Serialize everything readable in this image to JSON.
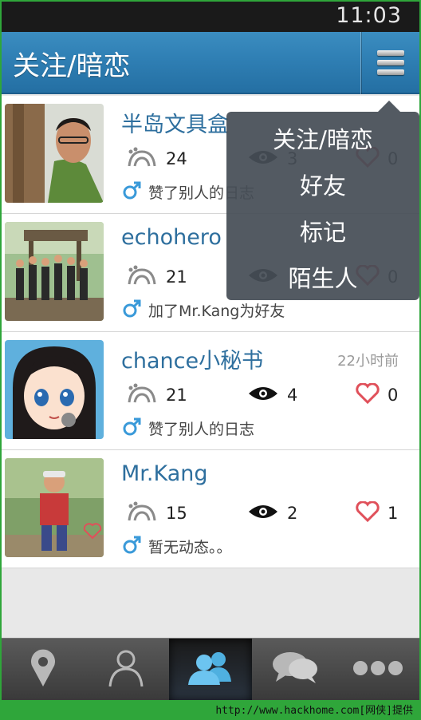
{
  "status_bar": {
    "time": "11:03"
  },
  "header": {
    "title": "关注/暗恋",
    "menu_icon": "menu-icon"
  },
  "popup_menu": {
    "items": [
      {
        "label": "关注/暗恋"
      },
      {
        "label": "好友"
      },
      {
        "label": "标记"
      },
      {
        "label": "陌生人"
      }
    ]
  },
  "users": [
    {
      "name": "半岛文具盒",
      "time": "",
      "footprints": "24",
      "views": "3",
      "likes": "0",
      "gender": "male",
      "activity": "赞了别人的日志",
      "has_badge": true
    },
    {
      "name": "echohero",
      "time": "",
      "footprints": "21",
      "views": "",
      "likes": "0",
      "gender": "male",
      "activity": "加了Mr.Kang为好友",
      "has_badge": true
    },
    {
      "name": "chance小秘书",
      "time": "22小时前",
      "footprints": "21",
      "views": "4",
      "likes": "0",
      "gender": "male",
      "activity": "赞了别人的日志",
      "has_badge": true
    },
    {
      "name": "Mr.Kang",
      "time": "",
      "footprints": "15",
      "views": "2",
      "likes": "1",
      "gender": "male",
      "activity": "暂无动态。。",
      "has_badge": false
    }
  ],
  "bottom_nav": {
    "tabs": [
      {
        "icon": "location-icon",
        "active": false
      },
      {
        "icon": "person-icon",
        "active": false
      },
      {
        "icon": "friends-icon",
        "active": true
      },
      {
        "icon": "chat-icon",
        "active": false
      },
      {
        "icon": "more-icon",
        "active": false
      }
    ]
  },
  "watermark": "http://www.hackhome.com[网侠]提供",
  "colors": {
    "accent": "#2f7fb4",
    "name_text": "#2e6f9e",
    "heart": "#e0505a",
    "gender": "#3a9ad9",
    "frame": "#2fa63a"
  }
}
